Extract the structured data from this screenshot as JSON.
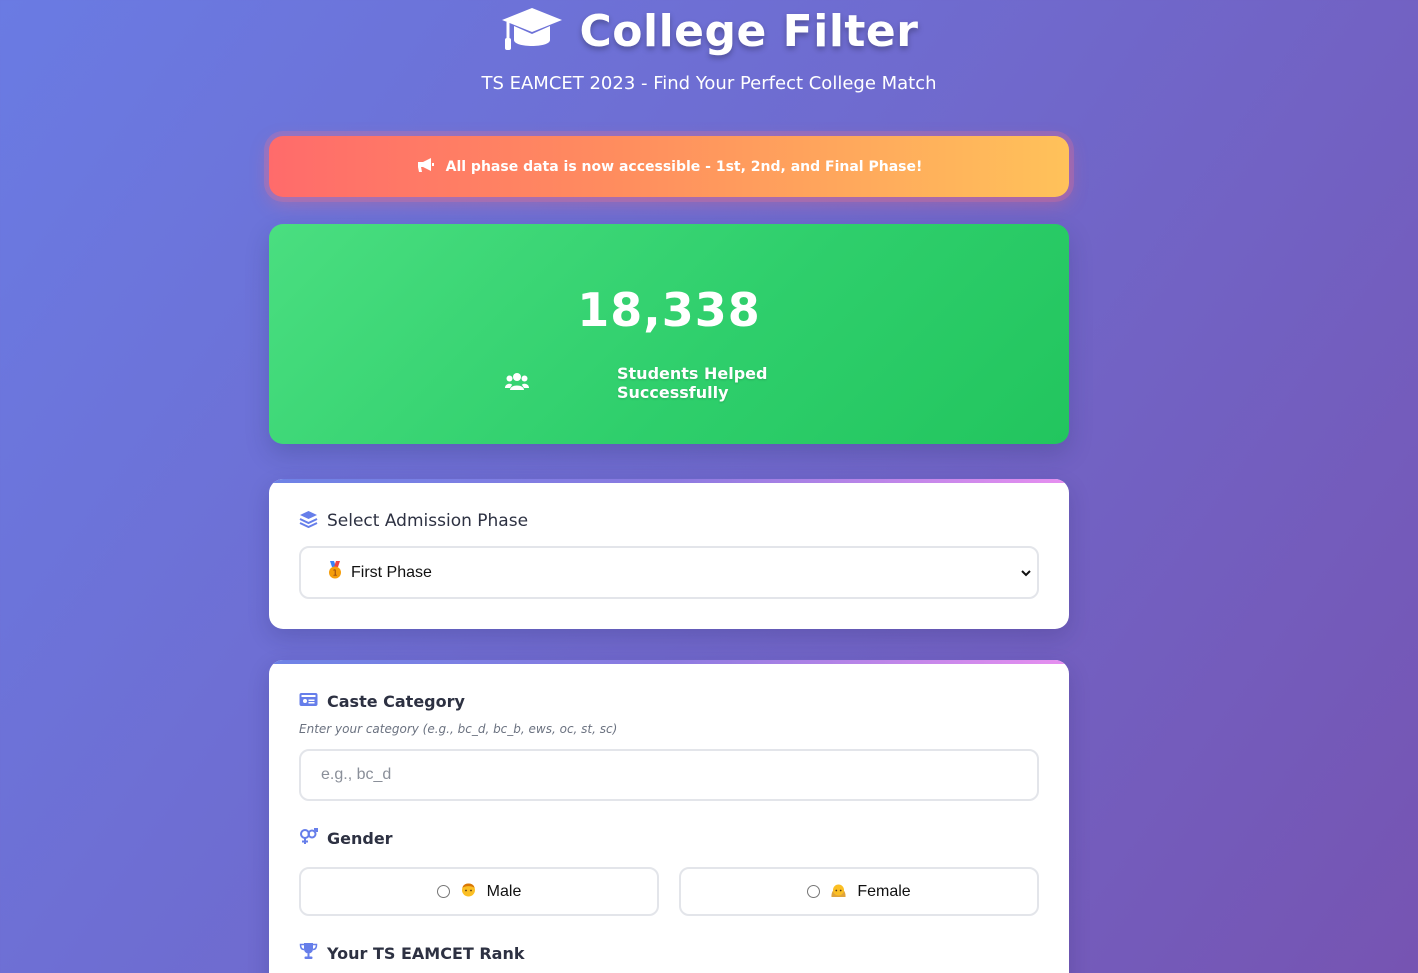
{
  "header": {
    "title": "College Filter",
    "subtitle": "TS EAMCET 2023 - Find Your Perfect College Match",
    "icon": "graduation-cap-icon"
  },
  "announcement": {
    "text": "All phase data is now accessible - 1st, 2nd, and Final Phase!",
    "icon": "megaphone-icon"
  },
  "stats": {
    "count": "18,338",
    "label": "Students Helped Successfully",
    "icon": "users-icon"
  },
  "phase_section": {
    "label": "Select Admission Phase",
    "icon": "layers-icon",
    "selected": "First Phase",
    "selected_icon": "medal-icon"
  },
  "form": {
    "caste": {
      "label": "Caste Category",
      "icon": "id-card-icon",
      "hint": "Enter your category (e.g., bc_d, bc_b, ews, oc, st, sc)",
      "placeholder": "e.g., bc_d",
      "value": ""
    },
    "gender": {
      "label": "Gender",
      "icon": "gender-icon",
      "options": [
        {
          "label": "Male",
          "icon": "man-emoji-icon",
          "checked": false
        },
        {
          "label": "Female",
          "icon": "woman-emoji-icon",
          "checked": false
        }
      ]
    },
    "rank": {
      "label": "Your TS EAMCET Rank",
      "icon": "trophy-icon"
    }
  },
  "colors": {
    "accent": "#667eea",
    "stats_green": "#22c55e",
    "banner_start": "#ff6b6b",
    "banner_end": "#ffc25a"
  }
}
